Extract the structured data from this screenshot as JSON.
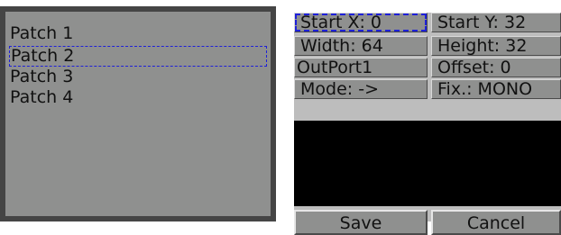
{
  "patch_list": {
    "items": [
      {
        "label": "Patch 1"
      },
      {
        "label": "Patch 2"
      },
      {
        "label": "Patch 3"
      },
      {
        "label": "Patch 4"
      }
    ],
    "focused_index": 1
  },
  "patch_settings": {
    "start_x": "Start X: 0",
    "start_y": "Start Y: 32",
    "width": "Width: 64",
    "height": "Height: 32",
    "out_port": "OutPort1",
    "offset": "Offset: 0",
    "mode": "Mode: ->",
    "fix": "Fix.: MONO"
  },
  "buttons": {
    "save": "Save",
    "cancel": "Cancel"
  },
  "colors": {
    "focus_outline": "#1e20d8",
    "panel_bg": "#8f908f",
    "preview_bg": "#000000"
  }
}
